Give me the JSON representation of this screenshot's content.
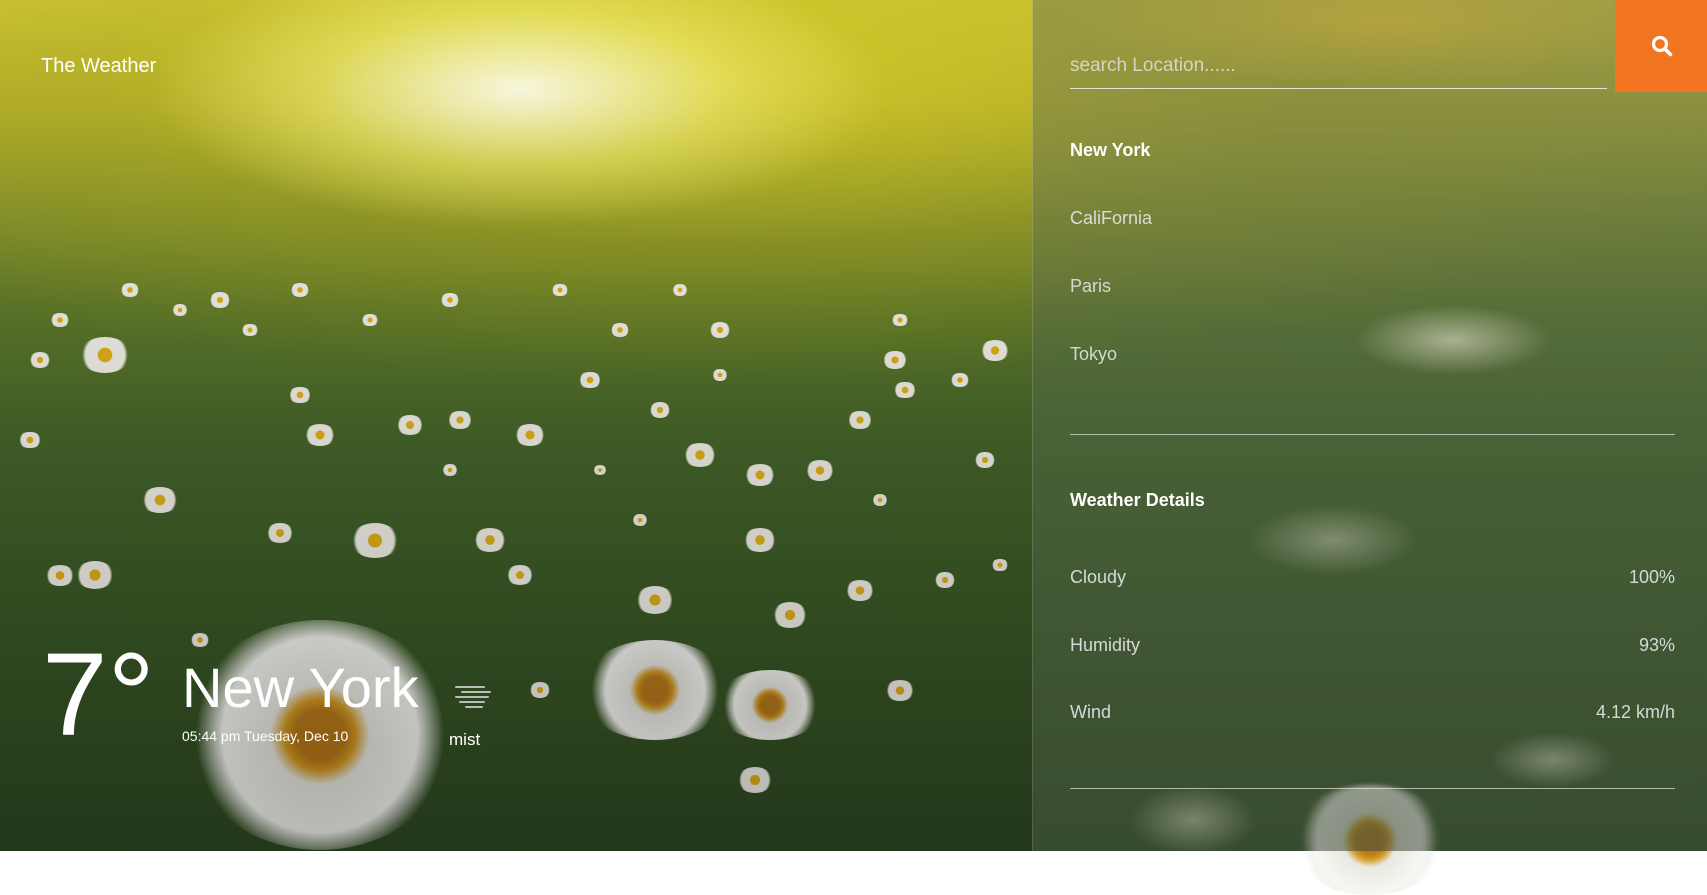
{
  "brand": {
    "title": "The Weather"
  },
  "current": {
    "temperature": "7°",
    "city": "New York",
    "datetime": "05:44 pm Tuesday, Dec 10",
    "condition": "mist",
    "condition_icon": "mist-icon"
  },
  "search": {
    "placeholder": "search Location......",
    "button_icon": "search-icon",
    "button_color": "#f27522"
  },
  "locations": [
    "New York",
    "CaliFornia",
    "Paris",
    "Tokyo"
  ],
  "details": {
    "title": "Weather Details",
    "rows": [
      {
        "label": "Cloudy",
        "value": "100%"
      },
      {
        "label": "Humidity",
        "value": "93%"
      },
      {
        "label": "Wind",
        "value": "4.12 km/h"
      }
    ]
  }
}
